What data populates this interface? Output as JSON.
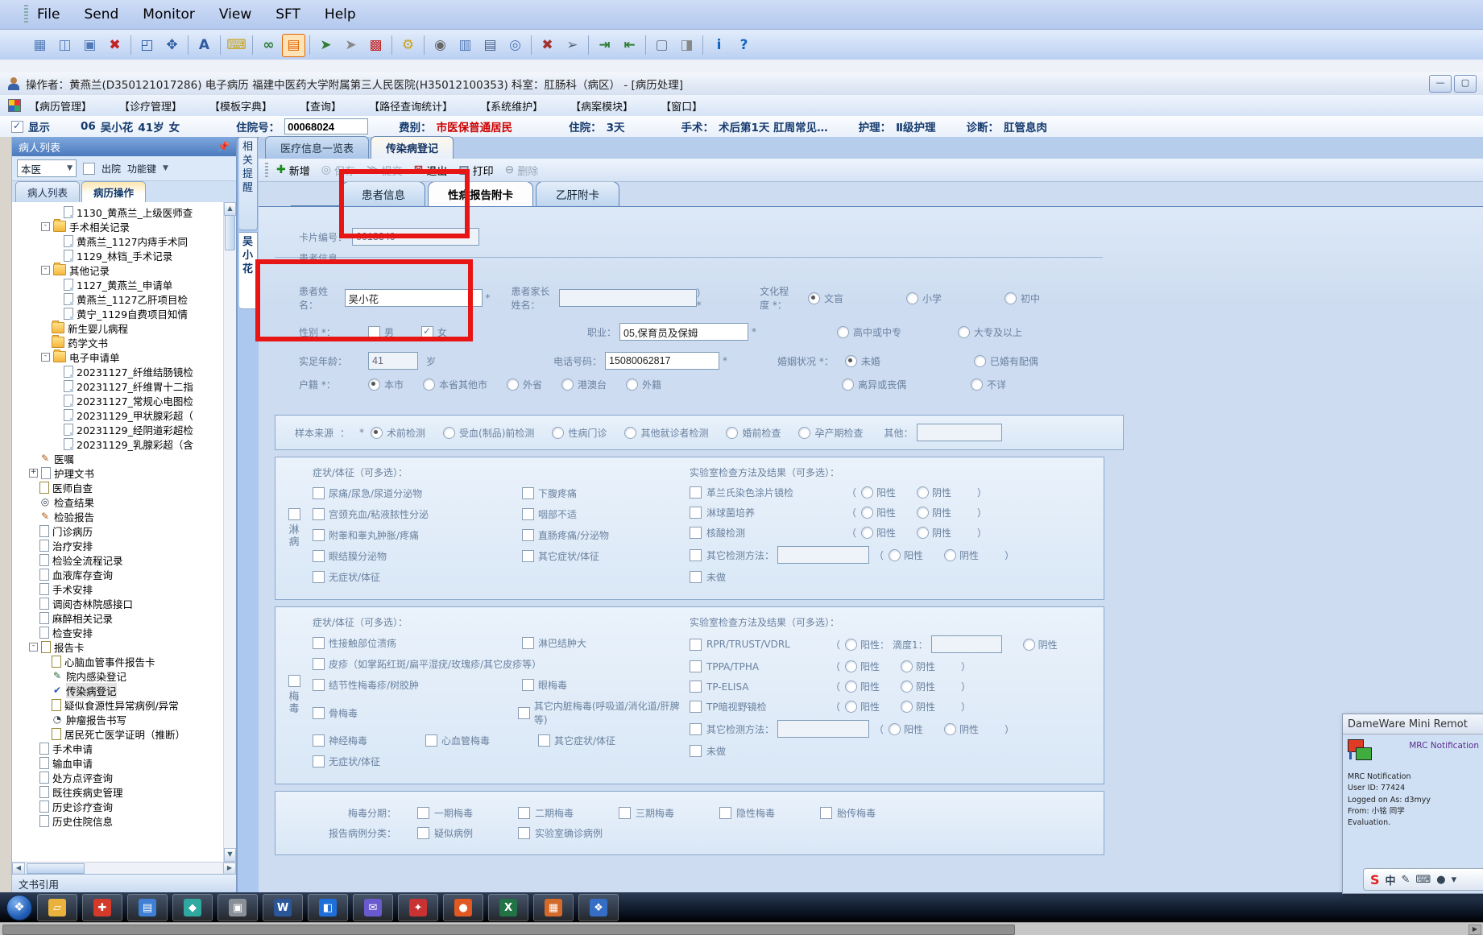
{
  "accent_colors": {
    "red_annotation": "#e81515",
    "fee_red": "#cc0000",
    "header_blue": "#4a79bd"
  },
  "dameware": {
    "menus": [
      "File",
      "Send",
      "Monitor",
      "View",
      "SFT",
      "Help"
    ],
    "toolbar": [
      {
        "name": "connect-icon",
        "g": "▦",
        "c": "#4f79b8"
      },
      {
        "name": "chat-icon",
        "g": "◫",
        "c": "#4f79b8"
      },
      {
        "name": "reconnect-icon",
        "g": "▣",
        "c": "#4f79b8"
      },
      {
        "name": "disconnect-icon",
        "g": "✖",
        "c": "#c22222",
        "sep": true
      },
      {
        "name": "screenshot-icon",
        "g": "◰",
        "c": "#2c5aa0"
      },
      {
        "name": "fullscreen-icon",
        "g": "✥",
        "c": "#2c5aa0",
        "sep": true
      },
      {
        "name": "font-icon",
        "g": "A",
        "c": "#2c5aa0",
        "sep": true
      },
      {
        "name": "keyboard-lock-icon",
        "g": "⌨",
        "c": "#caa21a",
        "sep": true
      },
      {
        "name": "view-only-icon",
        "g": "∞",
        "c": "#2e7d32"
      },
      {
        "name": "chat-session-icon",
        "g": "▤",
        "c": "#e06500",
        "active": true,
        "sep": true
      },
      {
        "name": "local-cursor-icon",
        "g": "➤",
        "c": "#2e7d32"
      },
      {
        "name": "remote-cursor-icon",
        "g": "➤",
        "c": "#888888"
      },
      {
        "name": "options-grid-icon",
        "g": "▩",
        "c": "#c22222",
        "sep": true
      },
      {
        "name": "settings-icon",
        "g": "⚙",
        "c": "#caa21a",
        "sep": true
      },
      {
        "name": "mouse-icon",
        "g": "◉",
        "c": "#666666"
      },
      {
        "name": "monitor-select-icon",
        "g": "▥",
        "c": "#4f79b8"
      },
      {
        "name": "print-screen-icon",
        "g": "▤",
        "c": "#44608a"
      },
      {
        "name": "zoom-icon",
        "g": "◎",
        "c": "#4f79b8",
        "sep": true
      },
      {
        "name": "no-cursor-icon",
        "g": "✖",
        "c": "#a33333"
      },
      {
        "name": "swap-cursor-icon",
        "g": "➢",
        "c": "#556677",
        "sep": true
      },
      {
        "name": "file-transfer-in-icon",
        "g": "⇥",
        "c": "#2e7d32"
      },
      {
        "name": "file-transfer-out-icon",
        "g": "⇤",
        "c": "#2e7d32",
        "sep": true
      },
      {
        "name": "frame-icon",
        "g": "▢",
        "c": "#667788"
      },
      {
        "name": "unlock-icon",
        "g": "◨",
        "c": "#888888",
        "sep": true
      },
      {
        "name": "info-icon",
        "g": "i",
        "c": "#1565c0"
      },
      {
        "name": "help-icon",
        "g": "?",
        "c": "#1565c0"
      }
    ]
  },
  "titlebar": {
    "text": "操作者：黄燕兰(D350121017286) 电子病历  福建中医药大学附属第三人民医院(H35012100353)  科室：肛肠科（病区） - [病历处理]",
    "minimize": "—",
    "maximize": "▢"
  },
  "menubar": {
    "items": [
      "【病历管理】",
      "【诊疗管理】",
      "【模板字典】",
      "【查询】",
      "【路径查询统计】",
      "【系统维护】",
      "【病案模块】",
      "【窗口】"
    ]
  },
  "patientbar": {
    "show_label": "显示",
    "bed": "06",
    "name": "吴小花",
    "age": "41岁",
    "sex": "女",
    "adm_label": "住院号：",
    "adm_value": "00068024",
    "fee_label": "费别：",
    "fee_value": "市医保普通居民",
    "stay_label": "住院：",
    "stay_value": "3天",
    "op_label": "手术：",
    "op_value": "术后第1天 肛周常见…",
    "care_label": "护理：",
    "care_value": "Ⅱ级护理",
    "diag_label": "诊断：",
    "diag_value": "肛管息肉"
  },
  "sidebar": {
    "header": "病人列表",
    "pin": "📌",
    "combo_value": "本医",
    "discharge_label": "出院",
    "funckey_label": "功能键",
    "tabs": [
      {
        "label": "病人列表",
        "active": false
      },
      {
        "label": "病历操作",
        "active": true
      }
    ],
    "tree": [
      {
        "lv": 3,
        "icon": "doc",
        "label": "1130_黄燕兰_上级医师查"
      },
      {
        "lv": 2,
        "icon": "folder-open",
        "label": "手术相关记录",
        "exp": "-"
      },
      {
        "lv": 3,
        "icon": "doc",
        "label": "黄燕兰_1127内痔手术同"
      },
      {
        "lv": 3,
        "icon": "doc",
        "label": "1129_林铛_手术记录"
      },
      {
        "lv": 2,
        "icon": "folder-open",
        "label": "其他记录",
        "exp": "-"
      },
      {
        "lv": 3,
        "icon": "doc",
        "label": "1127_黄燕兰_申请单"
      },
      {
        "lv": 3,
        "icon": "doc",
        "label": "黄燕兰_1127乙肝项目检"
      },
      {
        "lv": 3,
        "icon": "doc",
        "label": "黄宁_1129自费项目知情"
      },
      {
        "lv": 2,
        "icon": "folder",
        "label": "新生婴儿病程"
      },
      {
        "lv": 2,
        "icon": "folder",
        "label": "药学文书"
      },
      {
        "lv": 2,
        "icon": "folder-open",
        "label": "电子申请单",
        "exp": "-"
      },
      {
        "lv": 3,
        "icon": "doc",
        "label": "20231127_纤维结肠镜检"
      },
      {
        "lv": 3,
        "icon": "doc",
        "label": "20231127_纤维胃十二指"
      },
      {
        "lv": 3,
        "icon": "doc",
        "label": "20231127_常规心电图检"
      },
      {
        "lv": 3,
        "icon": "doc",
        "label": "20231129_甲状腺彩超（"
      },
      {
        "lv": 3,
        "icon": "doc",
        "label": "20231129_经阴道彩超检"
      },
      {
        "lv": 3,
        "icon": "doc",
        "label": "20231129_乳腺彩超（含"
      },
      {
        "lv": 1,
        "icon": "note",
        "label": "医嘱"
      },
      {
        "lv": 1,
        "icon": "page",
        "label": "护理文书",
        "exp": "+"
      },
      {
        "lv": 1,
        "icon": "page2",
        "label": "医师自查"
      },
      {
        "lv": 1,
        "icon": "search",
        "label": "检查结果"
      },
      {
        "lv": 1,
        "icon": "note",
        "label": "检验报告"
      },
      {
        "lv": 1,
        "icon": "page",
        "label": "门诊病历"
      },
      {
        "lv": 1,
        "icon": "page",
        "label": "治疗安排"
      },
      {
        "lv": 1,
        "icon": "page",
        "label": "检验全流程记录"
      },
      {
        "lv": 1,
        "icon": "page",
        "label": "血液库存查询"
      },
      {
        "lv": 1,
        "icon": "page",
        "label": "手术安排"
      },
      {
        "lv": 1,
        "icon": "page",
        "label": "调阅杏林院感接口"
      },
      {
        "lv": 1,
        "icon": "page",
        "label": "麻醉相关记录"
      },
      {
        "lv": 1,
        "icon": "page",
        "label": "检查安排"
      },
      {
        "lv": 1,
        "icon": "page2",
        "label": "报告卡",
        "exp": "-"
      },
      {
        "lv": 2,
        "icon": "page2",
        "label": "心脑血管事件报告卡"
      },
      {
        "lv": 2,
        "icon": "note2",
        "label": "院内感染登记"
      },
      {
        "lv": 2,
        "icon": "check",
        "label": "传染病登记",
        "sel": true
      },
      {
        "lv": 2,
        "icon": "page2",
        "label": "疑似食源性异常病例/异常"
      },
      {
        "lv": 2,
        "icon": "clock",
        "label": "肿瘤报告书写"
      },
      {
        "lv": 2,
        "icon": "page2",
        "label": "居民死亡医学证明（推断）"
      },
      {
        "lv": 1,
        "icon": "app",
        "label": "手术申请"
      },
      {
        "lv": 1,
        "icon": "app",
        "label": "输血申请"
      },
      {
        "lv": 1,
        "icon": "page",
        "label": "处方点评查询"
      },
      {
        "lv": 1,
        "icon": "page",
        "label": "既往疾病史管理"
      },
      {
        "lv": 1,
        "icon": "page",
        "label": "历史诊疗查询"
      },
      {
        "lv": 1,
        "icon": "page",
        "label": "历史住院信息"
      }
    ],
    "footer": "文书引用"
  },
  "main": {
    "reminder_strip": "相关提醒",
    "patient_strip": "吴小花",
    "tabs": [
      {
        "label": "医疗信息一览表",
        "active": false
      },
      {
        "label": "传染病登记",
        "active": true
      }
    ],
    "toolbar": [
      {
        "label": "新增",
        "g": "✚",
        "gc": "#1a8a1a",
        "en": true
      },
      {
        "label": "保存",
        "g": "◎",
        "gc": "#9aa7b8",
        "en": false
      },
      {
        "label": "提交",
        "g": "≫",
        "gc": "#9aa7b8",
        "en": false
      },
      {
        "label": "退出",
        "g": "⊠",
        "gc": "#b33333",
        "en": true
      },
      {
        "label": "打印",
        "g": "▤",
        "gc": "#334466",
        "en": true
      },
      {
        "label": "删除",
        "g": "⊖",
        "gc": "#9aa7b8",
        "en": false
      }
    ],
    "subtabs": [
      {
        "label": "患者信息",
        "active": false
      },
      {
        "label": "性病报告附卡",
        "active": true
      },
      {
        "label": "乙肝附卡",
        "active": false
      }
    ]
  },
  "form": {
    "card_label": "卡片编号：",
    "card_value": "0013340",
    "group_title": "患者信息",
    "name_label": "患者姓名：",
    "name_value": "吴小花",
    "name_star": "*",
    "guardian_label": "患者家长姓名：",
    "guardian_suffix": "） *",
    "edu_label": "文化程度 *：",
    "edu_options": [
      "文盲",
      "小学",
      "初中",
      "高中或中专",
      "大专及以上"
    ],
    "edu_selected": 0,
    "sex_label": "性别 *：",
    "sex_options": [
      {
        "label": "男",
        "checked": false
      },
      {
        "label": "女",
        "checked": true
      }
    ],
    "job_label": "职业：",
    "job_value": "05,保育员及保姆",
    "job_star": "*",
    "age_label": "实足年龄：",
    "age_value": "41",
    "age_unit": "岁",
    "phone_label": "电话号码：",
    "phone_value": "15080062817",
    "phone_star": "*",
    "marital_label": "婚姻状况 *：",
    "marital_options": [
      "未婚",
      "已婚有配偶",
      "离异或丧偶",
      "不详"
    ],
    "marital_selected": 0,
    "resid_label": "户籍 *：",
    "resid_options": [
      "本市",
      "本省其他市",
      "外省",
      "港澳台",
      "外籍"
    ],
    "resid_selected": 0,
    "sample_label": "样本来源",
    "sample_colon": "：",
    "sample_star": "*",
    "sample_options": [
      "术前检测",
      "受血(制品)前检测",
      "性病门诊",
      "其他就诊者检测",
      "婚前检查",
      "孕产期检查"
    ],
    "sample_selected": 0,
    "sample_other": "其他：",
    "result": {
      "pos": "阳性",
      "neg": "阴性",
      "lp": "（",
      "rp": "）"
    },
    "gono": {
      "side": "淋病",
      "sym_title": "症状/体征（可多选）：",
      "lab_title": "实验室检查方法及结果（可多选）：",
      "sym_rows": [
        [
          "尿痛/尿急/尿道分泌物",
          "下腹疼痛"
        ],
        [
          "宫颈充血/粘液脓性分泌",
          "咽部不适"
        ],
        [
          "附睾和睾丸肿胀/疼痛",
          "直肠疼痛/分泌物"
        ],
        [
          "眼结膜分泌物",
          "其它症状/体征"
        ],
        [
          "无症状/体征"
        ]
      ],
      "labs": [
        {
          "name": "革兰氏染色涂片镜检"
        },
        {
          "name": "淋球菌培养"
        },
        {
          "name": "核酸检测"
        },
        {
          "name": "其它检测方法：",
          "input": true
        },
        {
          "name": "未做",
          "plain": true
        }
      ]
    },
    "syph": {
      "side": "梅毒",
      "sym_title": "症状/体征（可多选）：",
      "lab_title": "实验室检查方法及结果（可多选）：",
      "sym_rows": [
        [
          "性接触部位溃疡",
          "淋巴结肿大"
        ],
        [
          "皮疹（如掌跖红斑/扁平湿疣/玫瑰疹/其它皮疹等）"
        ],
        [
          "结节性梅毒疹/树胶肿",
          "眼梅毒"
        ],
        [
          "骨梅毒",
          "其它内脏梅毒(呼吸道/消化道/肝脾等)"
        ],
        [
          "神经梅毒",
          "心血管梅毒",
          "其它症状/体征"
        ],
        [
          "无症状/体征"
        ]
      ],
      "labs": [
        {
          "name": "RPR/TRUST/VDRL",
          "titer": true,
          "pos_label": "阳性：",
          "titer_label": "滴度1："
        },
        {
          "name": "TPPA/TPHA"
        },
        {
          "name": "TP-ELISA"
        },
        {
          "name": "TP暗视野镜检"
        },
        {
          "name": "其它检测方法：",
          "input": true
        },
        {
          "name": "未做",
          "plain": true
        }
      ]
    },
    "staging_label": "梅毒分期：",
    "staging_options": [
      "一期梅毒",
      "二期梅毒",
      "三期梅毒",
      "隐性梅毒",
      "胎传梅毒"
    ],
    "class_label": "报告病例分类：",
    "class_options": [
      "疑似病例",
      "实验室确诊病例"
    ]
  },
  "popup": {
    "title": "DameWare Mini Remot",
    "badge": "MRC Notification",
    "lines": [
      "MRC Notification",
      "User ID: 77424",
      "Logged on As: d3myy",
      "From: 小铭 同学",
      "Evaluation."
    ]
  },
  "langbar": {
    "items": [
      {
        "g": "S",
        "red": true
      },
      {
        "g": "中"
      },
      {
        "g": "✎"
      },
      {
        "g": "⌨"
      },
      {
        "g": "●"
      },
      {
        "g": "▾"
      }
    ]
  },
  "taskbar": {
    "start": "❖",
    "tiles": [
      {
        "name": "folder-app",
        "c": "#e8b23c",
        "g": "▱"
      },
      {
        "name": "medical-app",
        "c": "#d43a2a",
        "g": "✚"
      },
      {
        "name": "blue-doc-app",
        "c": "#3f7fd4",
        "g": "▤"
      },
      {
        "name": "teal-app",
        "c": "#2fa8a0",
        "g": "◆"
      },
      {
        "name": "gray-app",
        "c": "#8a8f98",
        "g": "▣"
      },
      {
        "name": "word-app",
        "c": "#2b579a",
        "g": "W"
      },
      {
        "name": "window-app",
        "c": "#1e6fd9",
        "g": "◧"
      },
      {
        "name": "mail-app",
        "c": "#6a5acd",
        "g": "✉"
      },
      {
        "name": "white-logo-app",
        "c": "#c83232",
        "g": "✦"
      },
      {
        "name": "browser-app",
        "c": "#e25822",
        "g": "●"
      },
      {
        "name": "excel-app",
        "c": "#217346",
        "g": "X"
      },
      {
        "name": "orange-app",
        "c": "#d46a29",
        "g": "▦"
      },
      {
        "name": "blue2-app",
        "c": "#356ec4",
        "g": "❖"
      }
    ]
  }
}
